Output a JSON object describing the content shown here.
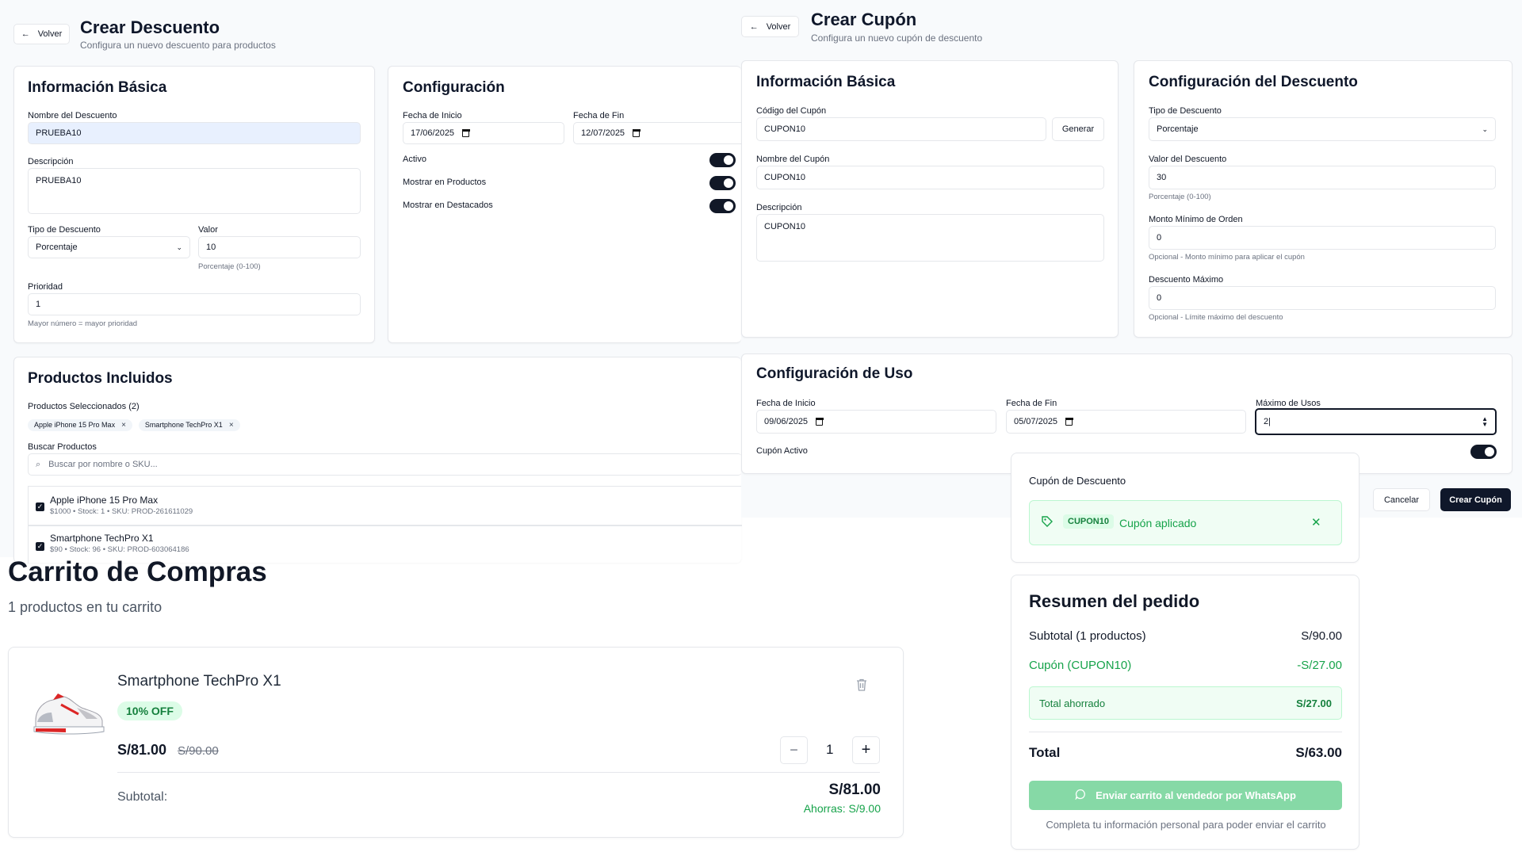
{
  "crear_descuento": {
    "back_label": "Volver",
    "title": "Crear Descuento",
    "subtitle": "Configura un nuevo descuento para productos",
    "info_basica": {
      "title": "Información Básica",
      "nombre_label": "Nombre del Descuento",
      "nombre_value": "PRUEBA10",
      "descripcion_label": "Descripción",
      "descripcion_value": "PRUEBA10",
      "tipo_label": "Tipo de Descuento",
      "tipo_value": "Porcentaje",
      "valor_label": "Valor",
      "valor_value": "10",
      "valor_hint": "Porcentaje (0-100)",
      "prioridad_label": "Prioridad",
      "prioridad_value": "1",
      "prioridad_hint": "Mayor número = mayor prioridad"
    },
    "configuracion": {
      "title": "Configuración",
      "fecha_inicio_label": "Fecha de Inicio",
      "fecha_inicio_value": "17/06/2025",
      "fecha_fin_label": "Fecha de Fin",
      "fecha_fin_value": "12/07/2025",
      "toggles": [
        {
          "label": "Activo",
          "on": true
        },
        {
          "label": "Mostrar en Productos",
          "on": true
        },
        {
          "label": "Mostrar en Destacados",
          "on": true
        }
      ]
    },
    "productos": {
      "title": "Productos Incluidos",
      "seleccionados_label": "Productos Seleccionados (2)",
      "chips": [
        "Apple iPhone 15 Pro Max",
        "Smartphone TechPro X1"
      ],
      "chip_remove": "×",
      "buscar_label": "Buscar Productos",
      "buscar_placeholder": "Buscar por nombre o SKU...",
      "items": [
        {
          "name": "Apple iPhone 15 Pro Max",
          "meta": "$1000 • Stock: 1 • SKU: PROD-261611029"
        },
        {
          "name": "Smartphone TechPro X1",
          "meta": "$90 • Stock: 96 • SKU: PROD-603064186"
        }
      ]
    }
  },
  "crear_cupon": {
    "back_label": "Volver",
    "title": "Crear Cupón",
    "subtitle": "Configura un nuevo cupón de descuento",
    "info_basica": {
      "title": "Información Básica",
      "codigo_label": "Código del Cupón",
      "codigo_value": "CUPON10",
      "generar_label": "Generar",
      "nombre_label": "Nombre del Cupón",
      "nombre_value": "CUPON10",
      "descripcion_label": "Descripción",
      "descripcion_value": "CUPON10"
    },
    "config_descuento": {
      "title": "Configuración del Descuento",
      "tipo_label": "Tipo de Descuento",
      "tipo_value": "Porcentaje",
      "valor_label": "Valor del Descuento",
      "valor_value": "30",
      "valor_hint": "Porcentaje (0-100)",
      "monto_label": "Monto Mínimo de Orden",
      "monto_value": "0",
      "monto_hint": "Opcional - Monto mínimo para aplicar el cupón",
      "max_label": "Descuento Máximo",
      "max_value": "0",
      "max_hint": "Opcional - Límite máximo del descuento"
    },
    "config_uso": {
      "title": "Configuración de Uso",
      "fecha_inicio_label": "Fecha de Inicio",
      "fecha_inicio_value": "09/06/2025",
      "fecha_fin_label": "Fecha de Fin",
      "fecha_fin_value": "05/07/2025",
      "max_usos_label": "Máximo de Usos",
      "max_usos_value": "2",
      "activo_label": "Cupón Activo"
    },
    "cancelar_label": "Cancelar",
    "crear_label": "Crear Cupón"
  },
  "carrito": {
    "title": "Carrito de Compras",
    "subtitle": "1 productos en tu carrito",
    "item": {
      "name": "Smartphone TechPro X1",
      "badge": "10% OFF",
      "price": "S/81.00",
      "old_price": "S/90.00",
      "quantity": "1",
      "minus": "−",
      "plus": "+",
      "subtotal_label": "Subtotal:",
      "subtotal_value": "S/81.00",
      "ahorras": "Ahorras: S/9.00"
    }
  },
  "cupon_card": {
    "title": "Cupón de Descuento",
    "code": "CUPON10",
    "status": "Cupón aplicado",
    "remove": "✕"
  },
  "resumen": {
    "title": "Resumen del pedido",
    "subtotal_label": "Subtotal (1 productos)",
    "subtotal_value": "S/90.00",
    "cupon_label": "Cupón (CUPON10)",
    "cupon_value": "-S/27.00",
    "ahorrado_label": "Total ahorrado",
    "ahorrado_value": "S/27.00",
    "total_label": "Total",
    "total_value": "S/63.00",
    "whatsapp_label": "Enviar carrito al vendedor por WhatsApp",
    "note": "Completa tu información personal para poder enviar el carrito"
  },
  "colors": {
    "dark": "#0f172a",
    "green": "#16a34a",
    "green_bg": "#f0fdf4",
    "whatsapp_btn": "#86d9a6"
  }
}
